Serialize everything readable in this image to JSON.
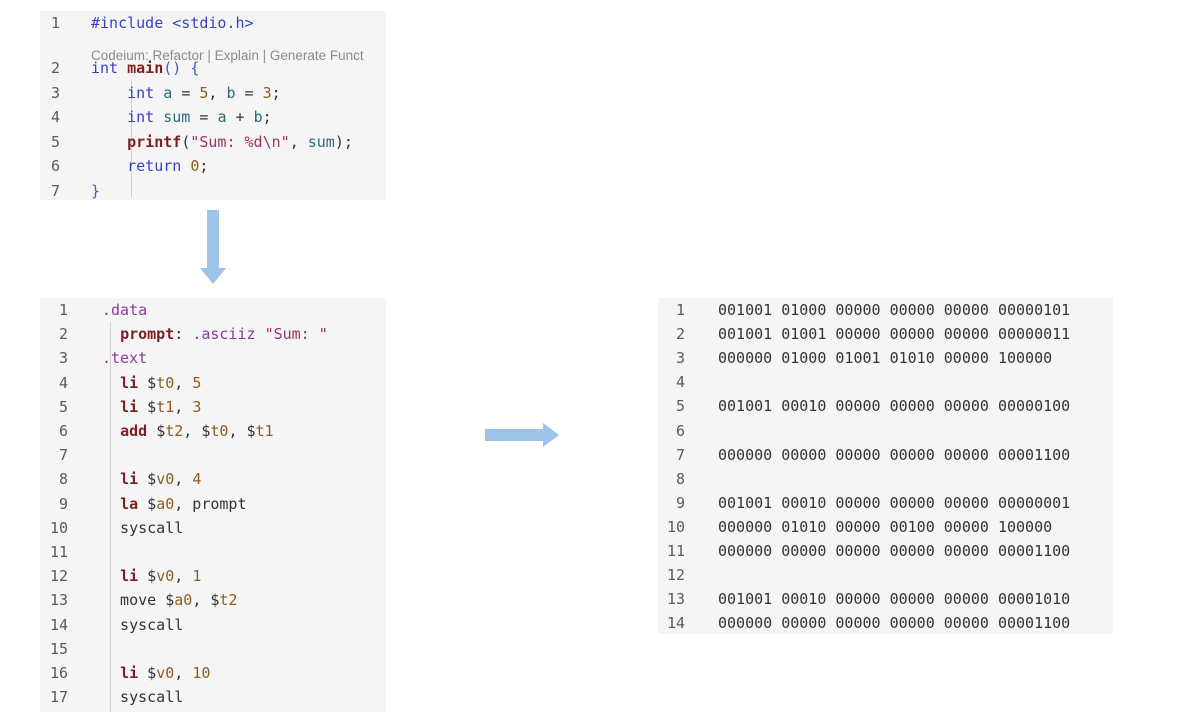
{
  "c_code": {
    "codelens": [
      "Codeium: Refactor",
      "Explain",
      "Generate Funct"
    ],
    "lines": [
      {
        "n": "1",
        "tokens": [
          [
            "pp",
            "#include <stdio.h>"
          ]
        ]
      },
      {
        "n": "2",
        "tokens": [
          [
            "type",
            "int "
          ],
          [
            "fn",
            "main"
          ],
          [
            "brace",
            "() {"
          ]
        ]
      },
      {
        "n": "3",
        "tokens": [
          [
            "plain",
            "    "
          ],
          [
            "kw",
            "int"
          ],
          [
            "var",
            " a "
          ],
          [
            "plain",
            "= "
          ],
          [
            "num",
            "5"
          ],
          [
            "plain",
            ", "
          ],
          [
            "var",
            "b "
          ],
          [
            "plain",
            "= "
          ],
          [
            "num",
            "3"
          ],
          [
            "plain",
            ";"
          ]
        ]
      },
      {
        "n": "4",
        "tokens": [
          [
            "plain",
            "    "
          ],
          [
            "kw",
            "int"
          ],
          [
            "var",
            " sum "
          ],
          [
            "plain",
            "= "
          ],
          [
            "var",
            "a "
          ],
          [
            "plain",
            "+ "
          ],
          [
            "var",
            "b"
          ],
          [
            "plain",
            ";"
          ]
        ]
      },
      {
        "n": "5",
        "tokens": [
          [
            "plain",
            "    "
          ],
          [
            "fn",
            "printf"
          ],
          [
            "plain",
            "("
          ],
          [
            "str",
            "\"Sum: %d\\n\""
          ],
          [
            "plain",
            ", "
          ],
          [
            "var",
            "sum"
          ],
          [
            "plain",
            ");"
          ]
        ]
      },
      {
        "n": "6",
        "tokens": [
          [
            "plain",
            "    "
          ],
          [
            "kw",
            "return "
          ],
          [
            "num",
            "0"
          ],
          [
            "plain",
            ";"
          ]
        ]
      },
      {
        "n": "7",
        "tokens": [
          [
            "brace",
            "}"
          ]
        ]
      }
    ]
  },
  "asm_code": {
    "lines": [
      {
        "n": "1",
        "tokens": [
          [
            "dir",
            ".data"
          ]
        ]
      },
      {
        "n": "2",
        "tokens": [
          [
            "plain",
            "  "
          ],
          [
            "lab",
            "prompt"
          ],
          [
            "plain",
            ": "
          ],
          [
            "dir",
            ".asciiz "
          ],
          [
            "str",
            "\"Sum: \""
          ]
        ]
      },
      {
        "n": "3",
        "tokens": [
          [
            "dir",
            ".text"
          ]
        ]
      },
      {
        "n": "4",
        "tokens": [
          [
            "plain",
            "  "
          ],
          [
            "inst",
            "li "
          ],
          [
            "plain",
            "$"
          ],
          [
            "reg",
            "t0"
          ],
          [
            "plain",
            ", "
          ],
          [
            "num",
            "5"
          ]
        ]
      },
      {
        "n": "5",
        "tokens": [
          [
            "plain",
            "  "
          ],
          [
            "inst",
            "li "
          ],
          [
            "plain",
            "$"
          ],
          [
            "reg",
            "t1"
          ],
          [
            "plain",
            ", "
          ],
          [
            "num",
            "3"
          ]
        ]
      },
      {
        "n": "6",
        "tokens": [
          [
            "plain",
            "  "
          ],
          [
            "inst",
            "add "
          ],
          [
            "plain",
            "$"
          ],
          [
            "reg",
            "t2"
          ],
          [
            "plain",
            ", $"
          ],
          [
            "reg",
            "t0"
          ],
          [
            "plain",
            ", $"
          ],
          [
            "reg",
            "t1"
          ]
        ]
      },
      {
        "n": "7",
        "tokens": []
      },
      {
        "n": "8",
        "tokens": [
          [
            "plain",
            "  "
          ],
          [
            "inst",
            "li "
          ],
          [
            "plain",
            "$"
          ],
          [
            "reg",
            "v0"
          ],
          [
            "plain",
            ", "
          ],
          [
            "num",
            "4"
          ]
        ]
      },
      {
        "n": "9",
        "tokens": [
          [
            "plain",
            "  "
          ],
          [
            "inst",
            "la "
          ],
          [
            "plain",
            "$"
          ],
          [
            "reg",
            "a0"
          ],
          [
            "plain",
            ", prompt"
          ]
        ]
      },
      {
        "n": "10",
        "tokens": [
          [
            "plain",
            "  syscall"
          ]
        ]
      },
      {
        "n": "11",
        "tokens": []
      },
      {
        "n": "12",
        "tokens": [
          [
            "plain",
            "  "
          ],
          [
            "inst",
            "li "
          ],
          [
            "plain",
            "$"
          ],
          [
            "reg",
            "v0"
          ],
          [
            "plain",
            ", "
          ],
          [
            "num",
            "1"
          ]
        ]
      },
      {
        "n": "13",
        "tokens": [
          [
            "plain",
            "  move $"
          ],
          [
            "reg",
            "a0"
          ],
          [
            "plain",
            ", $"
          ],
          [
            "reg",
            "t2"
          ]
        ]
      },
      {
        "n": "14",
        "tokens": [
          [
            "plain",
            "  syscall"
          ]
        ]
      },
      {
        "n": "15",
        "tokens": []
      },
      {
        "n": "16",
        "tokens": [
          [
            "plain",
            "  "
          ],
          [
            "inst",
            "li "
          ],
          [
            "plain",
            "$"
          ],
          [
            "reg",
            "v0"
          ],
          [
            "plain",
            ", "
          ],
          [
            "num",
            "10"
          ]
        ]
      },
      {
        "n": "17",
        "tokens": [
          [
            "plain",
            "  syscall"
          ]
        ]
      }
    ]
  },
  "binary_code": {
    "lines": [
      {
        "n": "1",
        "text": "001001 01000 00000 00000 00000 00000101"
      },
      {
        "n": "2",
        "text": "001001 01001 00000 00000 00000 00000011"
      },
      {
        "n": "3",
        "text": "000000 01000 01001 01010 00000 100000"
      },
      {
        "n": "4",
        "text": ""
      },
      {
        "n": "5",
        "text": "001001 00010 00000 00000 00000 00000100"
      },
      {
        "n": "6",
        "text": ""
      },
      {
        "n": "7",
        "text": "000000 00000 00000 00000 00000 00001100"
      },
      {
        "n": "8",
        "text": ""
      },
      {
        "n": "9",
        "text": "001001 00010 00000 00000 00000 00000001"
      },
      {
        "n": "10",
        "text": "000000 01010 00000 00100 00000 100000"
      },
      {
        "n": "11",
        "text": "000000 00000 00000 00000 00000 00001100"
      },
      {
        "n": "12",
        "text": ""
      },
      {
        "n": "13",
        "text": "001001 00010 00000 00000 00000 00001010"
      },
      {
        "n": "14",
        "text": "000000 00000 00000 00000 00000 00001100"
      }
    ]
  },
  "colors": {
    "arrow": "#9dc3e6",
    "panel_bg": "#f5f5f5"
  }
}
